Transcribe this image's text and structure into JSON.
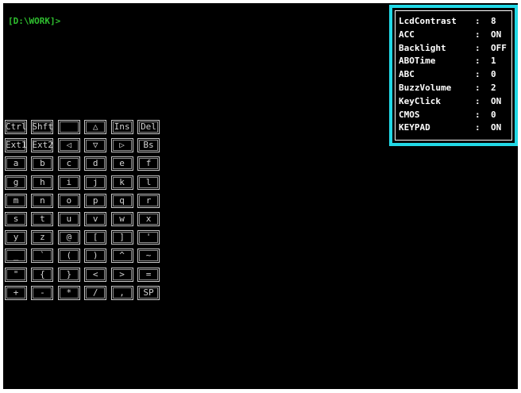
{
  "colors": {
    "screen_bg": "#000000",
    "prompt_color": "#2fbf2f",
    "settings_text": "#ffffff",
    "settings_border": "#22d8e6",
    "key_text": "#d2d2d2"
  },
  "terminal": {
    "prompt": "[D:\\WORK]>"
  },
  "settings": [
    {
      "name": "LcdContrast",
      "value": "8"
    },
    {
      "name": "ACC",
      "value": "ON"
    },
    {
      "name": "Backlight",
      "value": "OFF"
    },
    {
      "name": "ABOTime",
      "value": "1"
    },
    {
      "name": "ABC",
      "value": "0"
    },
    {
      "name": "BuzzVolume",
      "value": "2"
    },
    {
      "name": "KeyClick",
      "value": "ON"
    },
    {
      "name": "CMOS",
      "value": "0"
    },
    {
      "name": "KEYPAD",
      "value": "ON"
    }
  ],
  "keypad": {
    "rows": [
      [
        "Ctrl",
        "Shft",
        "",
        "△",
        "Ins",
        "Del"
      ],
      [
        "Ext1",
        "Ext2",
        "◁",
        "▽",
        "▷",
        "Bs"
      ],
      [
        "a",
        "b",
        "c",
        "d",
        "e",
        "f"
      ],
      [
        "g",
        "h",
        "i",
        "j",
        "k",
        "l"
      ],
      [
        "m",
        "n",
        "o",
        "p",
        "q",
        "r"
      ],
      [
        "s",
        "t",
        "u",
        "v",
        "w",
        "x"
      ],
      [
        "y",
        "z",
        "@",
        "[",
        "]",
        "'"
      ],
      [
        "_",
        "`",
        "(",
        ")",
        "^",
        "~"
      ],
      [
        "\"",
        "{",
        "}",
        "<",
        ">",
        "="
      ],
      [
        "+",
        "-",
        "*",
        "/",
        ",",
        "SP"
      ]
    ]
  }
}
